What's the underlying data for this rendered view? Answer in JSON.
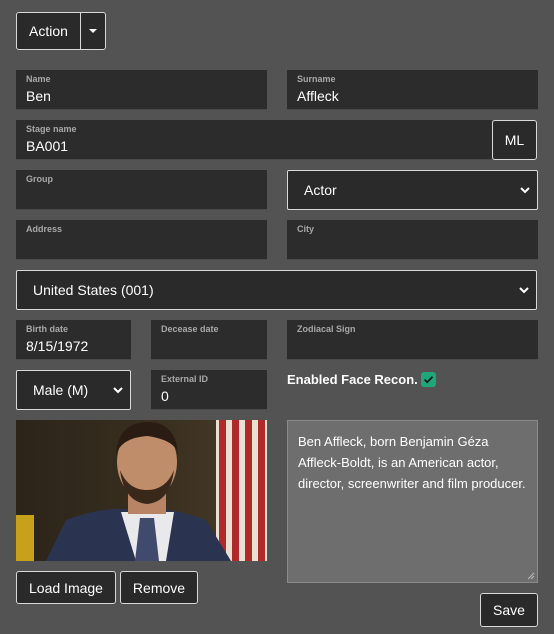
{
  "toolbar": {
    "action_label": "Action",
    "caret_icon": "caret-down-icon"
  },
  "fields": {
    "name": {
      "label": "Name",
      "value": "Ben"
    },
    "surname": {
      "label": "Surname",
      "value": "Affleck"
    },
    "stage_name": {
      "label": "Stage name",
      "value": "BA001"
    },
    "ml_button": "ML",
    "group": {
      "label": "Group",
      "value": ""
    },
    "role": {
      "selected": "Actor"
    },
    "address": {
      "label": "Address",
      "value": ""
    },
    "city": {
      "label": "City",
      "value": ""
    },
    "country": {
      "selected": "United States (001)"
    },
    "birth_date": {
      "label": "Birth date",
      "value": "8/15/1972"
    },
    "decease_date": {
      "label": "Decease date",
      "value": ""
    },
    "zodiacal_sign": {
      "label": "Zodiacal Sign",
      "value": ""
    },
    "gender": {
      "selected": "Male (M)"
    },
    "external_id": {
      "label": "External ID",
      "value": "0"
    },
    "face_recon": {
      "label": "Enabled Face Recon.",
      "checked": true
    }
  },
  "bio": "Ben Affleck, born Benjamin Géza Affleck-Boldt, is an American actor, director, screenwriter and film producer.",
  "buttons": {
    "load_image": "Load Image",
    "remove": "Remove",
    "save": "Save"
  },
  "colors": {
    "background": "#535353",
    "field": "#2c2c2c",
    "checkbox": "#1fa67a"
  }
}
